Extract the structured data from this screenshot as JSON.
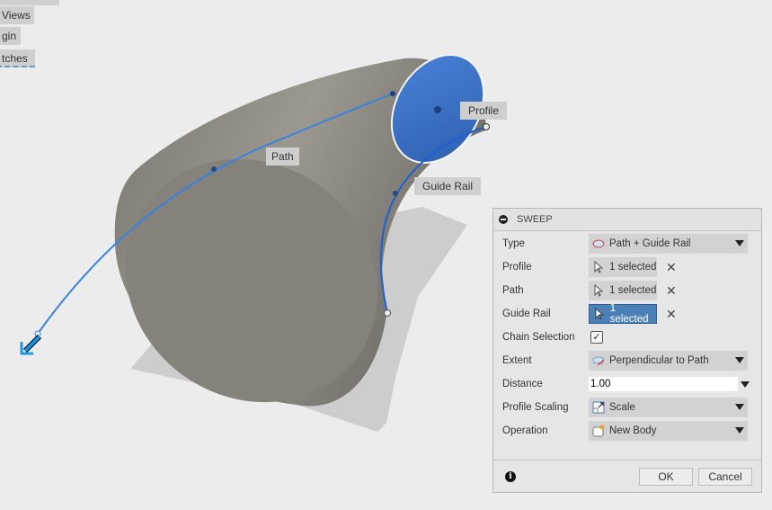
{
  "left_panel": {
    "items": [
      "Views",
      "gin",
      "tches"
    ]
  },
  "viewport": {
    "labels": {
      "path": "Path",
      "profile": "Profile",
      "guide_rail": "Guide Rail"
    }
  },
  "dialog": {
    "title": "SWEEP",
    "rows": {
      "type": {
        "label": "Type",
        "value": "Path + Guide Rail"
      },
      "profile": {
        "label": "Profile",
        "value": "1 selected"
      },
      "path": {
        "label": "Path",
        "value": "1 selected"
      },
      "guide_rail": {
        "label": "Guide Rail",
        "value": "1 selected"
      },
      "chain": {
        "label": "Chain Selection",
        "checked": true,
        "mark": "✓"
      },
      "extent": {
        "label": "Extent",
        "value": "Perpendicular to Path"
      },
      "distance": {
        "label": "Distance",
        "value": "1.00"
      },
      "scaling": {
        "label": "Profile Scaling",
        "value": "Scale"
      },
      "operation": {
        "label": "Operation",
        "value": "New Body"
      }
    },
    "clear_glyph": "✕",
    "info_glyph": "i",
    "ok": "OK",
    "cancel": "Cancel"
  },
  "colors": {
    "accent": "#4a7fb8",
    "profile": "#3a6fc8",
    "body": "#86847c"
  }
}
